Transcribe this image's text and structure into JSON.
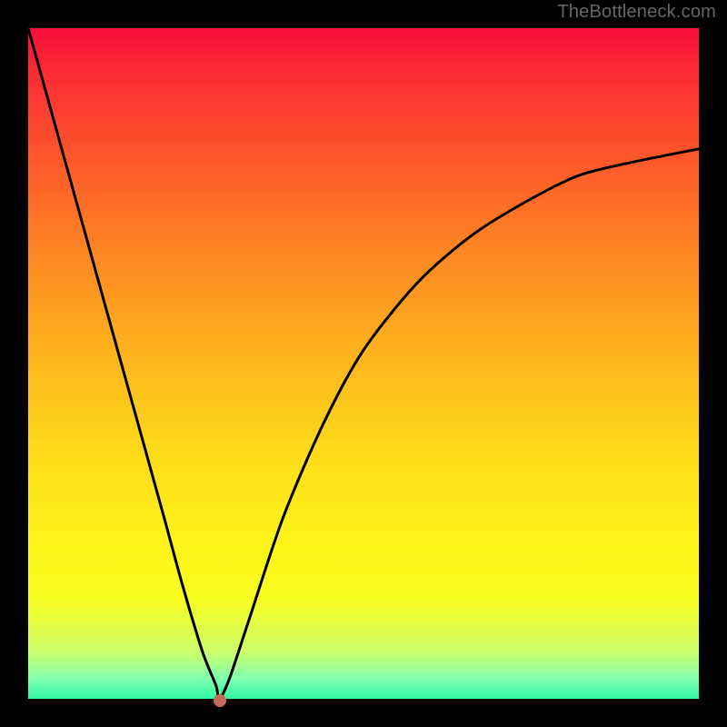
{
  "watermark": "TheBottleneck.com",
  "chart_data": {
    "type": "line",
    "title": "",
    "xlabel": "",
    "ylabel": "",
    "xlim": [
      0,
      1
    ],
    "ylim": [
      0,
      1
    ],
    "grid": false,
    "series": [
      {
        "name": "bottleneck-curve",
        "x": [
          0.0,
          0.05,
          0.1,
          0.15,
          0.2,
          0.23,
          0.26,
          0.28,
          0.285,
          0.3,
          0.33,
          0.38,
          0.44,
          0.5,
          0.58,
          0.66,
          0.74,
          0.82,
          0.9,
          1.0
        ],
        "y": [
          1.0,
          0.82,
          0.64,
          0.46,
          0.28,
          0.17,
          0.07,
          0.02,
          0.0,
          0.03,
          0.12,
          0.27,
          0.41,
          0.52,
          0.62,
          0.69,
          0.74,
          0.78,
          0.8,
          0.82
        ]
      }
    ],
    "marker": {
      "name": "highlight-dot",
      "x": 0.285,
      "y": 0.0,
      "color": "#c46a5a"
    },
    "background": {
      "type": "vertical-gradient",
      "stops": [
        {
          "pos": 0.0,
          "color": "#f80d3b"
        },
        {
          "pos": 0.5,
          "color": "#feb41d"
        },
        {
          "pos": 0.8,
          "color": "#fff41a"
        },
        {
          "pos": 1.0,
          "color": "#30f7a4"
        }
      ]
    }
  }
}
